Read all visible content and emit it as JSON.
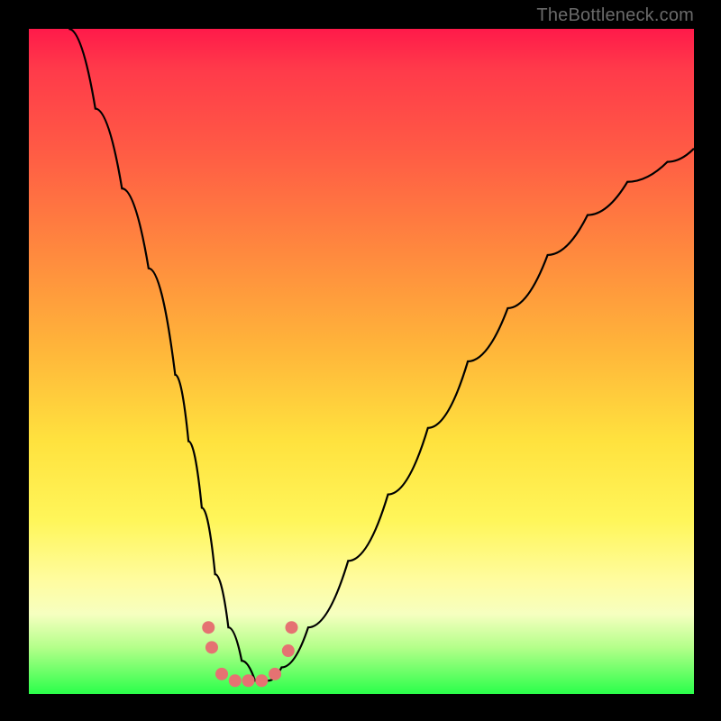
{
  "watermark": "TheBottleneck.com",
  "chart_data": {
    "type": "line",
    "title": "",
    "xlabel": "",
    "ylabel": "",
    "xlim": [
      0,
      100
    ],
    "ylim": [
      0,
      100
    ],
    "grid": false,
    "legend": false,
    "gradient_stops": [
      {
        "pos": 0,
        "color": "#ff1a4a"
      },
      {
        "pos": 18,
        "color": "#ff5a45"
      },
      {
        "pos": 48,
        "color": "#ffb53a"
      },
      {
        "pos": 74,
        "color": "#fff65a"
      },
      {
        "pos": 88,
        "color": "#f6ffc0"
      },
      {
        "pos": 100,
        "color": "#2aff4a"
      }
    ],
    "series": [
      {
        "name": "bottleneck-curve",
        "color": "#000000",
        "x": [
          6,
          10,
          14,
          18,
          22,
          24,
          26,
          28,
          30,
          32,
          34,
          36,
          38,
          42,
          48,
          54,
          60,
          66,
          72,
          78,
          84,
          90,
          96,
          100
        ],
        "y": [
          100,
          88,
          76,
          64,
          48,
          38,
          28,
          18,
          10,
          5,
          2,
          2,
          4,
          10,
          20,
          30,
          40,
          50,
          58,
          66,
          72,
          77,
          80,
          82
        ]
      }
    ],
    "markers": {
      "name": "bottleneck-dots",
      "color": "#e57272",
      "radius": 7,
      "points": [
        {
          "x": 27,
          "y": 10
        },
        {
          "x": 27.5,
          "y": 7
        },
        {
          "x": 29,
          "y": 3
        },
        {
          "x": 31,
          "y": 2
        },
        {
          "x": 33,
          "y": 2
        },
        {
          "x": 35,
          "y": 2
        },
        {
          "x": 37,
          "y": 3
        },
        {
          "x": 39,
          "y": 6.5
        },
        {
          "x": 39.5,
          "y": 10
        }
      ]
    }
  }
}
